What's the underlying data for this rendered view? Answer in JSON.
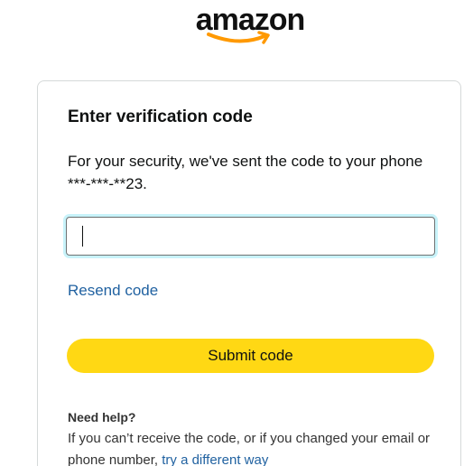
{
  "logo": {
    "text": "amazon",
    "smile_color": "#ff9900"
  },
  "card": {
    "title": "Enter verification code",
    "message": "For your security, we've sent the code to your phone ***-***-**23.",
    "input": {
      "value": "",
      "placeholder": ""
    },
    "resend_label": "Resend code",
    "submit_label": "Submit code"
  },
  "help": {
    "title": "Need help?",
    "text_before_link": "If you can’t receive the code, or if you changed your email or phone number, ",
    "link_label": "try a different way"
  },
  "colors": {
    "button": "#ffd814",
    "link": "#2162a1",
    "focus_ring": "#c8f3fa"
  }
}
